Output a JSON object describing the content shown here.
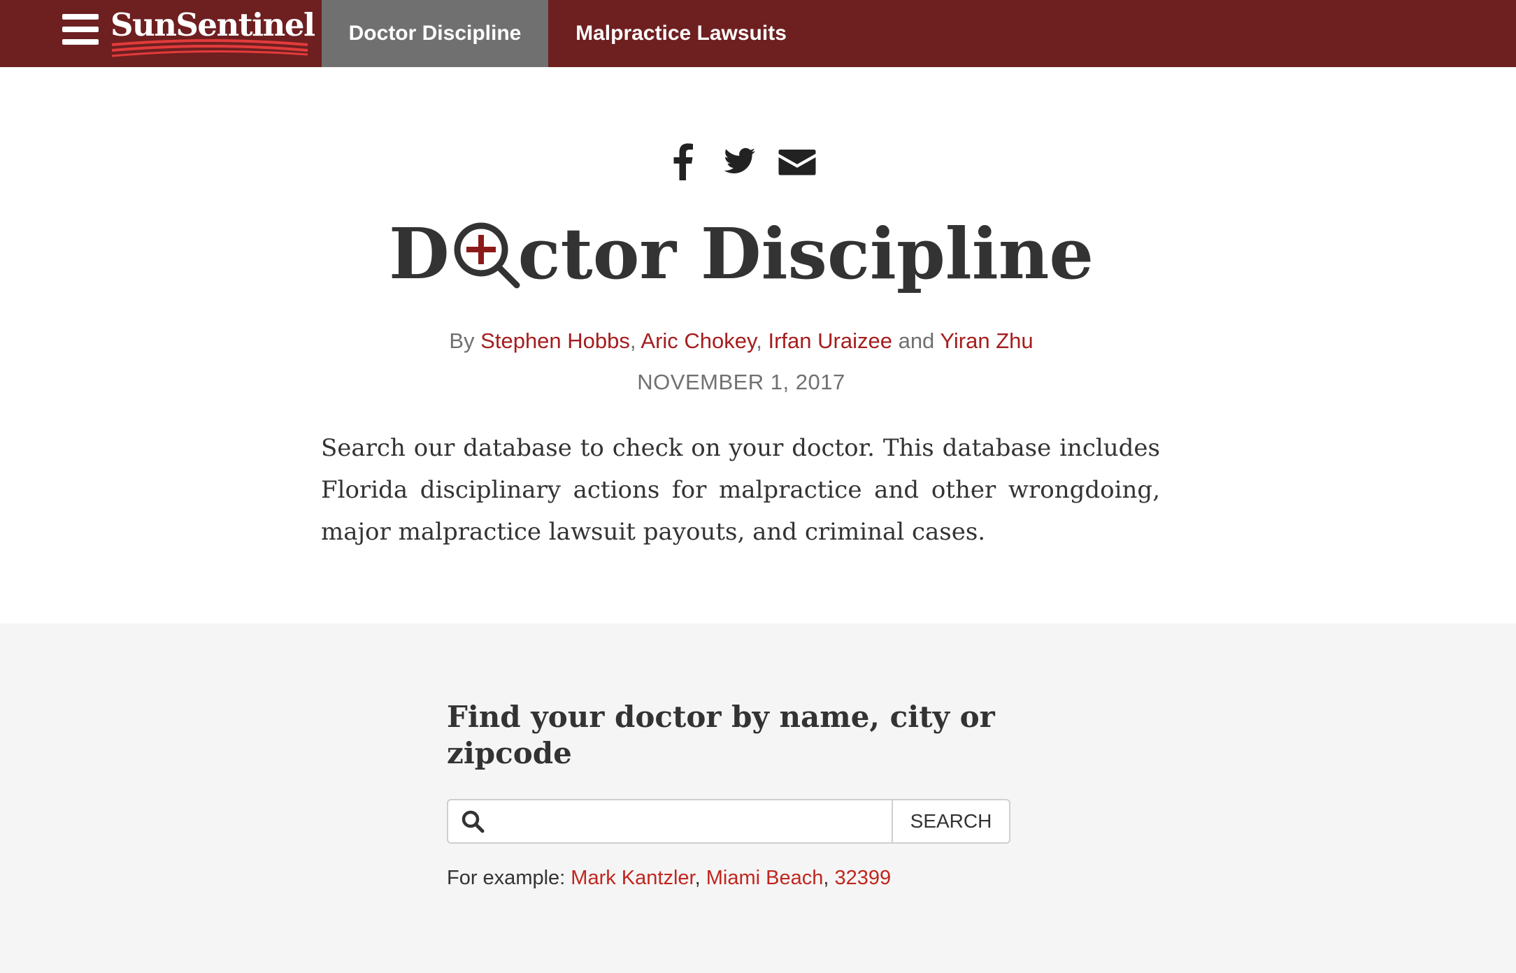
{
  "nav": {
    "logo_text": "SunSentinel",
    "tabs": [
      {
        "label": "Doctor Discipline",
        "active": true
      },
      {
        "label": "Malpractice Lawsuits",
        "active": false
      }
    ]
  },
  "share": {
    "icons": [
      "facebook-icon",
      "twitter-icon",
      "email-icon"
    ]
  },
  "article": {
    "title_before": "D",
    "title_after": "ctor Discipline",
    "byline_prefix": "By",
    "authors": [
      "Stephen Hobbs",
      "Aric Chokey",
      "Irfan Uraizee",
      "Yiran Zhu"
    ],
    "byline_sep": ",",
    "byline_and": "and",
    "date": "NOVEMBER 1, 2017",
    "intro": "Search our database to check on your doctor. This database includes Florida disciplinary actions for malpractice and other wrongdoing, major malpractice lawsuit payouts, and criminal cases."
  },
  "search": {
    "heading": "Find your doctor by name, city or zipcode",
    "input_value": "",
    "button_label": "SEARCH",
    "example_prefix": "For example:",
    "examples": [
      "Mark Kantzler",
      "Miami Beach",
      "32399"
    ],
    "example_sep": ","
  },
  "colors": {
    "nav_bg": "#6e1f20",
    "active_tab_bg": "#707070",
    "link": "#a51d1d",
    "section_bg": "#f5f5f5"
  }
}
